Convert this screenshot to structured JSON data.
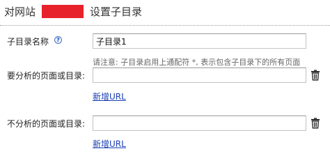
{
  "header": {
    "prefix": "对网站",
    "redacted_color": "#e8222a",
    "title": "设置子目录"
  },
  "form": {
    "subdir_name": {
      "label": "子目录名称",
      "help_icon": "question-circle-icon",
      "help_glyph": "?",
      "value": "子目录1"
    },
    "note": "请注意: 子目录启用上通配符 *, 表示包含子目录下的所有页面",
    "include_pages": {
      "label": "要分析的页面或目录:",
      "value": "",
      "delete_icon": "trash-icon",
      "add_link": "新增URL"
    },
    "exclude_pages": {
      "label": "不分析的页面或目录:",
      "value": "",
      "delete_icon": "trash-icon",
      "add_link": "新增URL"
    }
  },
  "colors": {
    "link": "#1a3fb5",
    "note": "#666666",
    "redaction": "#e8222a"
  }
}
